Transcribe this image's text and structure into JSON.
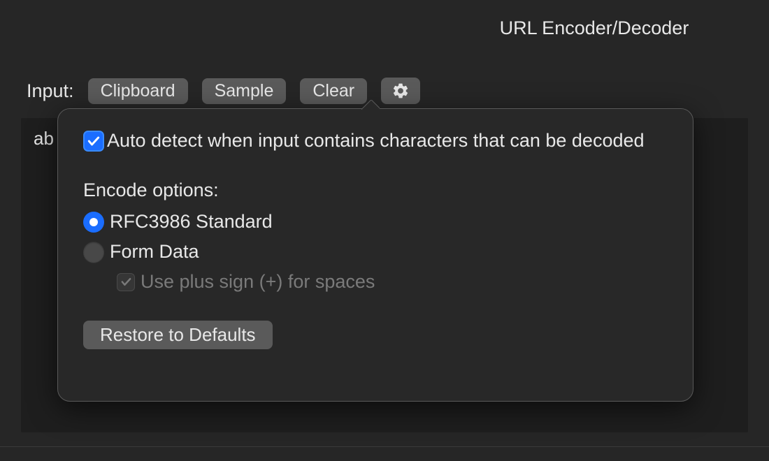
{
  "header": {
    "title": "URL Encoder/Decoder"
  },
  "toolbar": {
    "input_label": "Input:",
    "clipboard_label": "Clipboard",
    "sample_label": "Sample",
    "clear_label": "Clear"
  },
  "input": {
    "value": "ab"
  },
  "settings_popover": {
    "auto_detect_label": "Auto detect when input contains characters that can be decoded",
    "auto_detect_checked": true,
    "encode_heading": "Encode options:",
    "radio_rfc_label": "RFC3986 Standard",
    "radio_rfc_selected": true,
    "radio_form_label": "Form Data",
    "radio_form_selected": false,
    "plus_sign_label": "Use plus sign (+) for spaces",
    "plus_sign_checked": true,
    "restore_label": "Restore to Defaults"
  }
}
